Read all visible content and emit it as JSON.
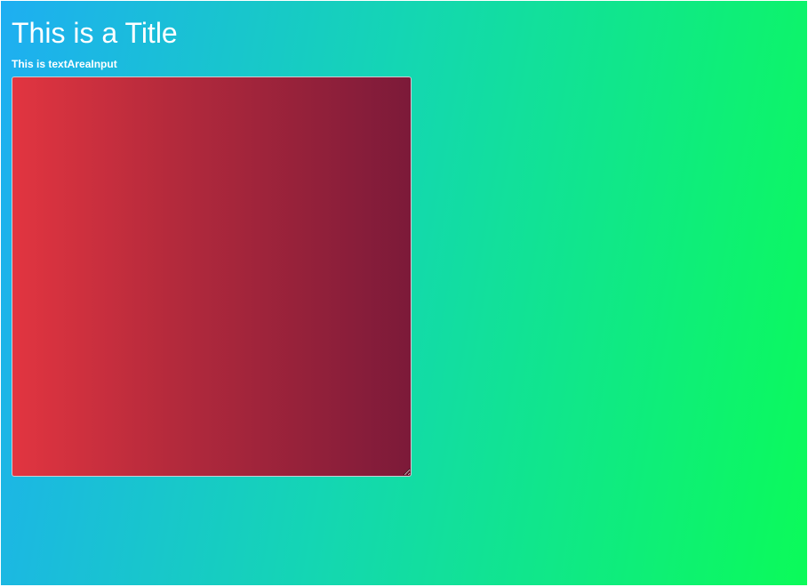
{
  "page": {
    "title": "This is a Title"
  },
  "form": {
    "textarea_label": "This is textAreaInput",
    "textarea_value": "",
    "textarea_placeholder": ""
  },
  "colors": {
    "background_gradient": [
      "#1eaef2",
      "#14d6b3",
      "#0bfb59"
    ],
    "textarea_gradient": [
      "#e23540",
      "#b42a3c",
      "#7c1a39"
    ],
    "text": "#ffffff"
  }
}
